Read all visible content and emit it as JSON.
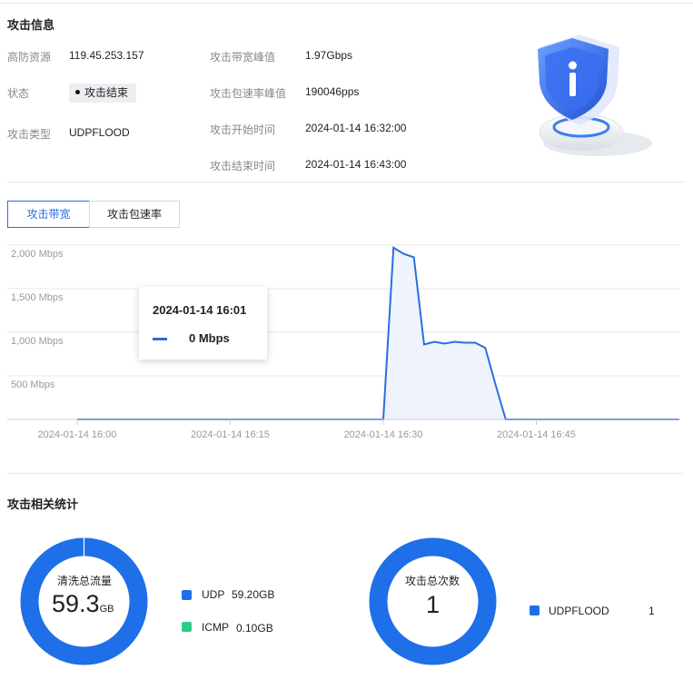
{
  "attack_info": {
    "title": "攻击信息",
    "rows": [
      {
        "label": "高防资源",
        "value": "119.45.253.157"
      },
      {
        "label": "状态",
        "value": "攻击结束"
      },
      {
        "label": "攻击类型",
        "value": "UDPFLOOD"
      }
    ],
    "right_rows": [
      {
        "label": "攻击带宽峰值",
        "value": "1.97Gbps"
      },
      {
        "label": "攻击包速率峰值",
        "value": "190046pps"
      },
      {
        "label": "攻击开始时间",
        "value": "2024-01-14 16:32:00"
      },
      {
        "label": "攻击结束时间",
        "value": "2024-01-14 16:43:00"
      }
    ]
  },
  "tabs": [
    {
      "label": "攻击带宽",
      "active": true
    },
    {
      "label": "攻击包速率",
      "active": false
    }
  ],
  "chart_data": {
    "type": "area",
    "ylabel_ticks": [
      "2,000 Mbps",
      "1,500 Mbps",
      "1,000 Mbps",
      "500 Mbps"
    ],
    "y_tick_values": [
      2000,
      1500,
      1000,
      500
    ],
    "ylim": [
      0,
      2000
    ],
    "x_tick_labels": [
      "2024-01-14 16:00",
      "2024-01-14 16:15",
      "2024-01-14 16:30",
      "2024-01-14 16:45"
    ],
    "x_tick_minutes": [
      0,
      15,
      30,
      45
    ],
    "xlim_minutes": [
      0,
      59
    ],
    "series": [
      {
        "x_minutes": [
          0,
          30,
          31,
          32,
          33,
          34,
          35,
          36,
          37,
          38,
          39,
          40,
          41,
          42,
          59
        ],
        "values": [
          0,
          0,
          1970,
          1900,
          1860,
          860,
          890,
          870,
          890,
          880,
          880,
          820,
          400,
          0,
          0
        ]
      }
    ],
    "color": "#2a6ee0",
    "fill": "#eef3fc",
    "grid": true
  },
  "tooltip": {
    "time": "2024-01-14 16:01",
    "value": "0 Mbps"
  },
  "stats": {
    "title": "攻击相关统计",
    "traffic": {
      "label": "清洗总流量",
      "value": "59.3",
      "unit": "GB",
      "legend": [
        {
          "name": "UDP",
          "value": "59.20GB",
          "color": "#1e6fe8"
        },
        {
          "name": "ICMP",
          "value": "0.10GB",
          "color": "#2ecc8a"
        }
      ],
      "fractions": [
        0.9983,
        0.0017
      ]
    },
    "count": {
      "label": "攻击总次数",
      "value": "1",
      "legend": [
        {
          "name": "UDPFLOOD",
          "value": "1",
          "color": "#1e6fe8"
        }
      ]
    }
  }
}
